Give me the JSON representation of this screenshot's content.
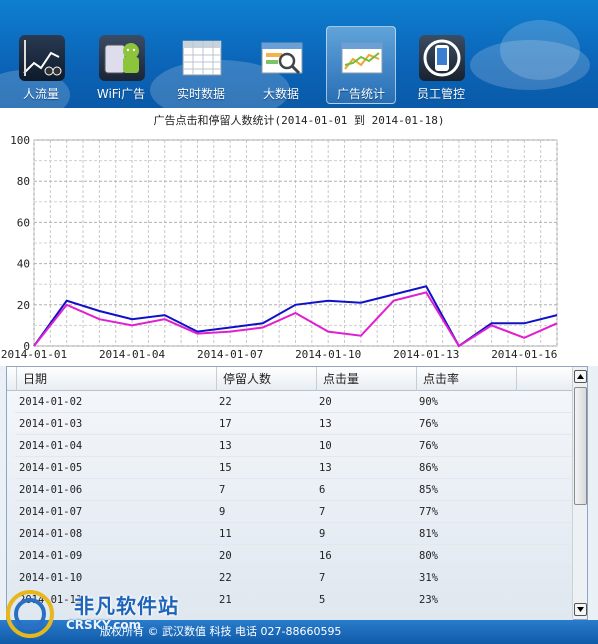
{
  "toolbar": {
    "items": [
      {
        "label": "人流量",
        "icon": "people-flow-chart-icon",
        "active": false
      },
      {
        "label": "WiFi广告",
        "icon": "android-wifi-icon",
        "active": false
      },
      {
        "label": "实时数据",
        "icon": "spreadsheet-icon",
        "active": false
      },
      {
        "label": "大数据",
        "icon": "magnifier-data-icon",
        "active": false
      },
      {
        "label": "广告统计",
        "icon": "line-chart-icon",
        "active": true
      },
      {
        "label": "员工管控",
        "icon": "phone-control-icon",
        "active": false
      }
    ]
  },
  "chart_data": {
    "type": "line",
    "title": "广告点击和停留人数统计(2014-01-01 到 2014-01-18)",
    "x": [
      "2014-01-01",
      "2014-01-02",
      "2014-01-03",
      "2014-01-04",
      "2014-01-05",
      "2014-01-06",
      "2014-01-07",
      "2014-01-08",
      "2014-01-09",
      "2014-01-10",
      "2014-01-11",
      "2014-01-12",
      "2014-01-13",
      "2014-01-14",
      "2014-01-15",
      "2014-01-16",
      "2014-01-17",
      "2014-01-18"
    ],
    "x_tick_labels": [
      "2014-01-01",
      "2014-01-04",
      "2014-01-07",
      "2014-01-10",
      "2014-01-13",
      "2014-01-16"
    ],
    "y_ticks": [
      "0",
      "20",
      "40",
      "60",
      "80",
      "100"
    ],
    "ylim": [
      0,
      100
    ],
    "grid": true,
    "series": [
      {
        "values": [
          0,
          22,
          17,
          13,
          15,
          7,
          9,
          11,
          20,
          22,
          21,
          25,
          29,
          0,
          11,
          11,
          15
        ],
        "color": "#1010c8"
      },
      {
        "values": [
          0,
          20,
          13,
          10,
          13,
          6,
          7,
          9,
          16,
          7,
          5,
          22,
          26,
          0,
          10,
          4,
          11
        ],
        "color": "#e020d0"
      }
    ]
  },
  "table": {
    "columns": [
      "日期",
      "停留人数",
      "点击量",
      "点击率"
    ],
    "rows": [
      [
        "2014-01-02",
        "22",
        "20",
        "90%"
      ],
      [
        "2014-01-03",
        "17",
        "13",
        "76%"
      ],
      [
        "2014-01-04",
        "13",
        "10",
        "76%"
      ],
      [
        "2014-01-05",
        "15",
        "13",
        "86%"
      ],
      [
        "2014-01-06",
        "7",
        "6",
        "85%"
      ],
      [
        "2014-01-07",
        "9",
        "7",
        "77%"
      ],
      [
        "2014-01-08",
        "11",
        "9",
        "81%"
      ],
      [
        "2014-01-09",
        "20",
        "16",
        "80%"
      ],
      [
        "2014-01-10",
        "22",
        "7",
        "31%"
      ],
      [
        "2014-01-11",
        "21",
        "5",
        "23%"
      ]
    ]
  },
  "status": {
    "text": "版权所有 ©  武汉数值 科技  电话 027-88660595"
  },
  "watermark": {
    "text": "非凡软件站",
    "sub": "CRSKY.com"
  }
}
